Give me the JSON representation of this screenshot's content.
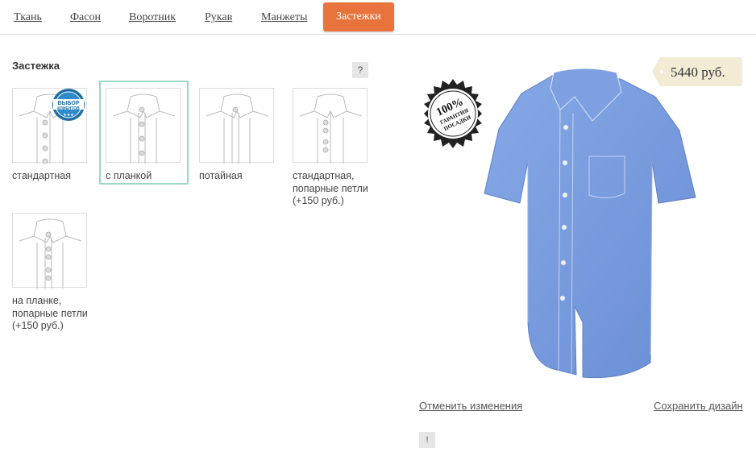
{
  "tabs": [
    {
      "label": "Ткань"
    },
    {
      "label": "Фасон"
    },
    {
      "label": "Воротник"
    },
    {
      "label": "Рукав"
    },
    {
      "label": "Манжеты"
    },
    {
      "label": "Застежки",
      "active": true
    }
  ],
  "panel": {
    "title": "Застежка",
    "help": "?",
    "options": [
      {
        "label": "стандартная",
        "badge": "customer-choice",
        "selected": false
      },
      {
        "label": "с планкой",
        "selected": true
      },
      {
        "label": "потайная",
        "selected": false
      },
      {
        "label": "стандартная, попарные петли (+150 руб.)",
        "selected": false
      },
      {
        "label": "на планке, попарные петли (+150 руб.)",
        "selected": false
      }
    ],
    "badge_text": [
      "ВЫБОР",
      "КЛИЕНТОВ"
    ]
  },
  "preview": {
    "price": "5440 руб.",
    "guarantee_text": [
      "100%",
      "ГАРАНТИЯ",
      "ПОСАДКИ"
    ],
    "cancel_label": "Отменить изменения",
    "save_label": "Сохранить дизайн",
    "info": "!",
    "shirt_color": "#7a9fe0"
  },
  "colors": {
    "accent": "#e8733d",
    "selected_border": "#9ad9c2"
  }
}
